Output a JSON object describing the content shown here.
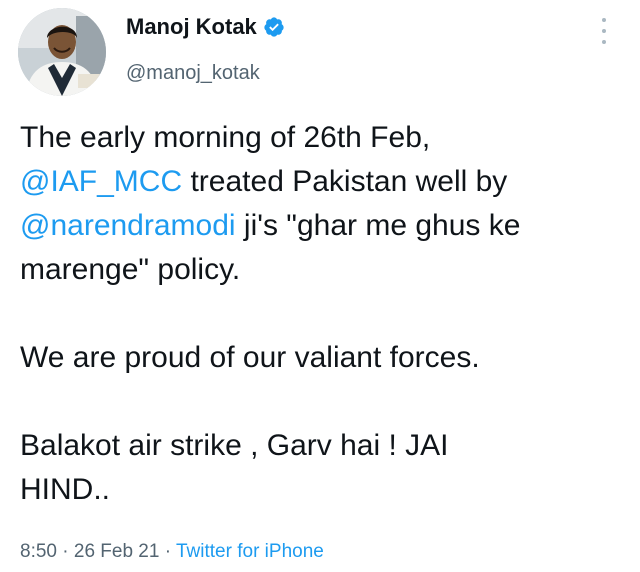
{
  "author": {
    "display_name": "Manoj Kotak",
    "handle": "@manoj_kotak",
    "verified": true,
    "verified_color": "#1d9bf0"
  },
  "tweet": {
    "line1": "The early morning of 26th Feb,",
    "line2_mention": "@IAF_MCC",
    "line2_text": " treated Pakistan well by",
    "line3_mention": "@narendramodi",
    "line3_text": " ji's \"ghar me ghus ke",
    "line4": "marenge\" policy.",
    "line5": "We are proud of our valiant forces.",
    "line6": "Balakot air strike , Garv hai ! JAI",
    "line7": "HIND.."
  },
  "meta": {
    "time": "8:50",
    "sep1": " · ",
    "date": "26 Feb 21",
    "sep2": " · ",
    "source": "Twitter for iPhone"
  },
  "colors": {
    "link": "#1d9bf0",
    "text": "#0f1419",
    "muted": "#536471"
  },
  "icons": {
    "verified": "verified-badge-icon",
    "more": "more-options-icon"
  }
}
